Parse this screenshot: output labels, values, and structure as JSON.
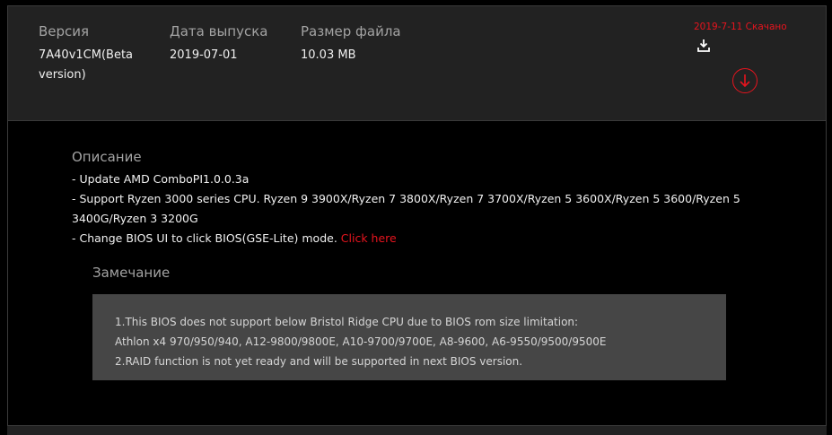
{
  "header": {
    "version_label": "Версия",
    "version_value": "7A40v1CM(Beta version)",
    "date_label": "Дата выпуска",
    "date_value": "2019-07-01",
    "size_label": "Размер файла",
    "size_value": "10.03 MB",
    "download_status": "2019-7-11 Скачано",
    "accent_color": "#e6141e"
  },
  "description": {
    "title": "Описание",
    "lines": [
      "- Update AMD ComboPI1.0.0.3a",
      "- Support Ryzen 3000 series CPU. Ryzen 9 3900X/Ryzen 7 3800X/Ryzen 7 3700X/Ryzen 5 3600X/Ryzen 5 3600/Ryzen 5 3400G/Ryzen 3 3200G",
      "- Change BIOS UI to click BIOS(GSE-Lite) mode."
    ],
    "link_text": "Click here"
  },
  "note": {
    "title": "Замечание",
    "lines": [
      "1.This BIOS does not support below Bristol Ridge CPU due to BIOS rom size limitation:",
      "Athlon x4 970/950/940, A12-9800/9800E, A10-9700/9700E, A8-9600, A6-9550/9500/9500E",
      "2.RAID function is not yet ready and will be supported in next BIOS version."
    ]
  },
  "icons": {
    "download_small": "download-tray-icon",
    "download_circle": "download-circle-icon"
  }
}
